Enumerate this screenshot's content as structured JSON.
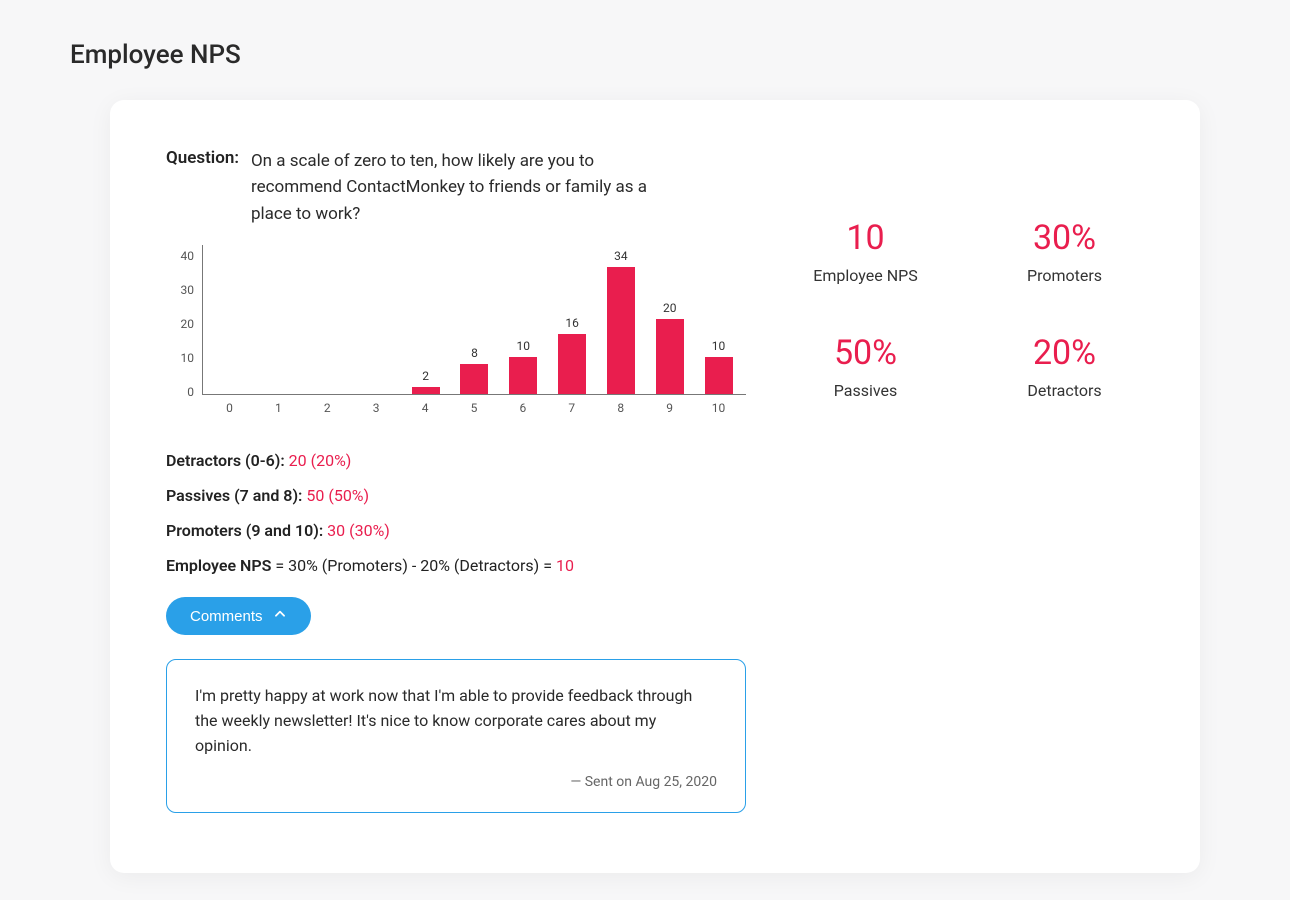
{
  "page_title": "Employee NPS",
  "question": {
    "label": "Question:",
    "text": "On a scale of zero to ten, how likely are you to recommend ContactMonkey to friends or family as a place to work?"
  },
  "chart_data": {
    "type": "bar",
    "title": "",
    "xlabel": "",
    "ylabel": "",
    "categories": [
      "0",
      "1",
      "2",
      "3",
      "4",
      "5",
      "6",
      "7",
      "8",
      "9",
      "10"
    ],
    "values": [
      0,
      0,
      0,
      0,
      2,
      8,
      10,
      16,
      34,
      20,
      10
    ],
    "ylim": [
      0,
      40
    ],
    "y_ticks": [
      0,
      10,
      20,
      30,
      40
    ],
    "bar_color": "#e91e4e"
  },
  "breakdown": {
    "detractors": {
      "label": "Detractors (0-6):",
      "value": "20 (20%)"
    },
    "passives": {
      "label": "Passives (7 and 8):",
      "value": "50 (50%)"
    },
    "promoters": {
      "label": "Promoters (9 and 10):",
      "value": "30 (30%)"
    },
    "formula": {
      "lhs": "Employee NPS",
      "mid": " = 30% (Promoters) - 20% (Detractors) = ",
      "result": "10"
    }
  },
  "comments": {
    "button_label": "Comments",
    "items": [
      {
        "text": "I'm pretty happy at work now that I'm able to provide feedback through the weekly newsletter! It's nice to know corporate cares about my opinion.",
        "meta_prefix": "— Sent on ",
        "date": "Aug 25, 2020"
      }
    ]
  },
  "metrics": {
    "nps": {
      "value": "10",
      "label": "Employee NPS"
    },
    "promoters": {
      "value": "30%",
      "label": "Promoters"
    },
    "passives": {
      "value": "50%",
      "label": "Passives"
    },
    "detractors": {
      "value": "20%",
      "label": "Detractors"
    }
  }
}
